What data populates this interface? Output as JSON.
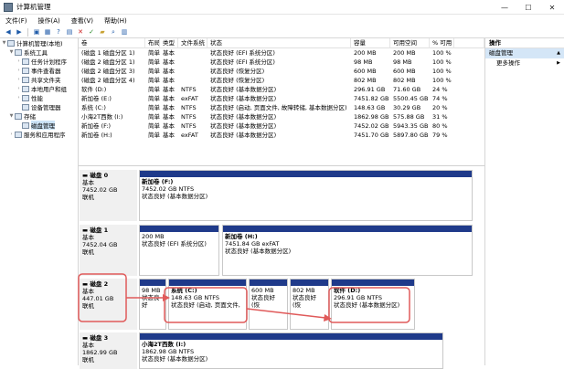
{
  "window": {
    "title": "计算机管理"
  },
  "menu": [
    "文件(F)",
    "操作(A)",
    "查看(V)",
    "帮助(H)"
  ],
  "toolbar_icons": [
    "back-icon",
    "forward-icon",
    "up-icon",
    "grid-icon",
    "help-icon",
    "properties-icon",
    "close-icon",
    "check-icon",
    "folder-icon",
    "search-icon",
    "view-icon"
  ],
  "tree": [
    {
      "label": "计算机管理(本地)",
      "level": 0,
      "arrow": "▼"
    },
    {
      "label": "系统工具",
      "level": 1,
      "arrow": "▼"
    },
    {
      "label": "任务计划程序",
      "level": 2,
      "arrow": "›"
    },
    {
      "label": "事件查看器",
      "level": 2,
      "arrow": "›"
    },
    {
      "label": "共享文件夹",
      "level": 2,
      "arrow": "›"
    },
    {
      "label": "本地用户和组",
      "level": 2,
      "arrow": "›"
    },
    {
      "label": "性能",
      "level": 2,
      "arrow": "›"
    },
    {
      "label": "设备管理器",
      "level": 2,
      "arrow": ""
    },
    {
      "label": "存储",
      "level": 1,
      "arrow": "▼"
    },
    {
      "label": "磁盘管理",
      "level": 2,
      "arrow": "",
      "selected": true
    },
    {
      "label": "服务和应用程序",
      "level": 1,
      "arrow": "›"
    }
  ],
  "grid": {
    "headers": [
      "卷",
      "布局",
      "类型",
      "文件系统",
      "状态",
      "容量",
      "可用空间",
      "% 可用"
    ],
    "rows": [
      [
        "(磁盘 1 磁盘分区 1)",
        "简单",
        "基本",
        "",
        "状态良好 (EFI 系统分区)",
        "200 MB",
        "200 MB",
        "100 %"
      ],
      [
        "(磁盘 2 磁盘分区 1)",
        "简单",
        "基本",
        "",
        "状态良好 (EFI 系统分区)",
        "98 MB",
        "98 MB",
        "100 %"
      ],
      [
        "(磁盘 2 磁盘分区 3)",
        "简单",
        "基本",
        "",
        "状态良好 (恢复分区)",
        "600 MB",
        "600 MB",
        "100 %"
      ],
      [
        "(磁盘 2 磁盘分区 4)",
        "简单",
        "基本",
        "",
        "状态良好 (恢复分区)",
        "802 MB",
        "802 MB",
        "100 %"
      ],
      [
        "软件 (D:)",
        "简单",
        "基本",
        "NTFS",
        "状态良好 (基本数据分区)",
        "296.91 GB",
        "71.60 GB",
        "24 %"
      ],
      [
        "新加卷 (E:)",
        "简单",
        "基本",
        "exFAT",
        "状态良好 (基本数据分区)",
        "7451.82 GB",
        "5500.45 GB",
        "74 %"
      ],
      [
        "系统 (C:)",
        "简单",
        "基本",
        "NTFS",
        "状态良好 (启动, 页面文件, 故障转储, 基本数据分区)",
        "148.63 GB",
        "30.29 GB",
        "20 %"
      ],
      [
        "小海2T西数 (I:)",
        "简单",
        "基本",
        "NTFS",
        "状态良好 (基本数据分区)",
        "1862.98 GB",
        "575.88 GB",
        "31 %"
      ],
      [
        "新加卷 (F:)",
        "简单",
        "基本",
        "NTFS",
        "状态良好 (基本数据分区)",
        "7452.02 GB",
        "5943.35 GB",
        "80 %"
      ],
      [
        "新加卷 (H:)",
        "简单",
        "基本",
        "exFAT",
        "状态良好 (基本数据分区)",
        "7451.70 GB",
        "5897.80 GB",
        "79 %"
      ]
    ]
  },
  "disks": [
    {
      "name": "磁盘 0",
      "type": "基本",
      "size": "7452.02 GB",
      "status": "联机",
      "parts": [
        {
          "name": "新加卷 (F:)",
          "size": "7452.02 GB NTFS",
          "status": "状态良好 (基本数据分区)"
        }
      ]
    },
    {
      "name": "磁盘 1",
      "type": "基本",
      "size": "7452.04 GB",
      "status": "联机",
      "parts": [
        {
          "name": "",
          "size": "200 MB",
          "status": "状态良好 (EFI 系统分区)"
        },
        {
          "name": "新加卷 (H:)",
          "size": "7451.84 GB exFAT",
          "status": "状态良好 (基本数据分区)"
        }
      ]
    },
    {
      "name": "磁盘 2",
      "type": "基本",
      "size": "447.01 GB",
      "status": "联机",
      "parts": [
        {
          "name": "",
          "size": "98 MB",
          "status": "状态良好"
        },
        {
          "name": "系统 (C:)",
          "size": "148.63 GB NTFS",
          "status": "状态良好 (启动, 页面文件,"
        },
        {
          "name": "",
          "size": "600 MB",
          "status": "状态良好 (恢"
        },
        {
          "name": "",
          "size": "802 MB",
          "status": "状态良好 (恢"
        },
        {
          "name": "软件 (D:)",
          "size": "296.91 GB NTFS",
          "status": "状态良好 (基本数据分区)"
        }
      ]
    },
    {
      "name": "磁盘 3",
      "type": "基本",
      "size": "1862.99 GB",
      "status": "联机",
      "parts": [
        {
          "name": "小海2T西数 (I:)",
          "size": "1862.98 GB NTFS",
          "status": "状态良好 (基本数据分区)"
        }
      ]
    }
  ],
  "actions": {
    "header": "操作",
    "section": "磁盘管理",
    "item": "更多操作"
  },
  "colors": {
    "partition_bar": "#1f3a8a",
    "selection": "#cce4f7",
    "annotation": "#e05a5a"
  }
}
